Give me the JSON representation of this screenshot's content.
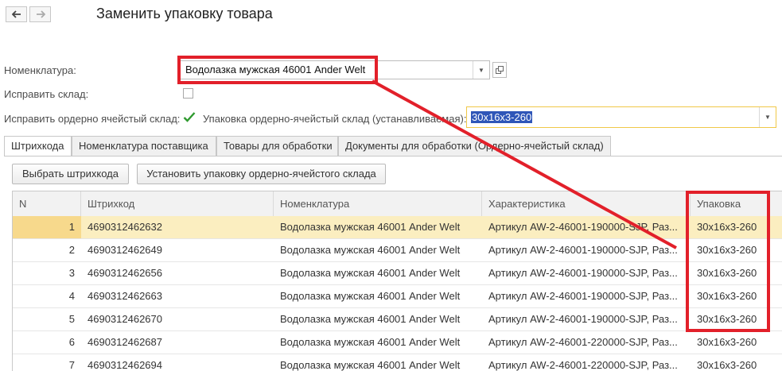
{
  "window": {
    "title": "Заменить упаковку товара"
  },
  "form": {
    "nomenclature_label": "Номенклатура:",
    "nomenclature_value": "Водолазка мужская 46001 Ander Welt",
    "fix_warehouse_label": "Исправить склад:",
    "fix_warehouse_checked": false,
    "fix_cell_warehouse_label": "Исправить ордерно ячейстый склад:",
    "fix_cell_warehouse_checked": true,
    "packaging_label": "Упаковка ордерно-ячейстый склад (устанавливаемая):",
    "packaging_value": "30x16x3-260"
  },
  "tabs": [
    {
      "label": "Штрихкода",
      "active": true
    },
    {
      "label": "Номенклатура поставщика",
      "active": false
    },
    {
      "label": "Товары для обработки",
      "active": false
    },
    {
      "label": "Документы для обработки (Ордерно-ячейстый склад)",
      "active": false
    }
  ],
  "toolbar": {
    "select_barcodes": "Выбрать штрихкода",
    "set_packaging": "Установить упаковку ордерно-ячейстого склада"
  },
  "table": {
    "columns": [
      "N",
      "Штрихкод",
      "Номенклатура",
      "Характеристика",
      "Упаковка"
    ],
    "rows": [
      {
        "n": "1",
        "barcode": "4690312462632",
        "nomenclature": "Водолазка мужская 46001 Ander Welt",
        "characteristic": "Артикул AW-2-46001-190000-SJP, Раз...",
        "packaging": "30x16x3-260"
      },
      {
        "n": "2",
        "barcode": "4690312462649",
        "nomenclature": "Водолазка мужская 46001 Ander Welt",
        "characteristic": "Артикул AW-2-46001-190000-SJP, Раз...",
        "packaging": "30x16x3-260"
      },
      {
        "n": "3",
        "barcode": "4690312462656",
        "nomenclature": "Водолазка мужская 46001 Ander Welt",
        "characteristic": "Артикул AW-2-46001-190000-SJP, Раз...",
        "packaging": "30x16x3-260"
      },
      {
        "n": "4",
        "barcode": "4690312462663",
        "nomenclature": "Водолазка мужская 46001 Ander Welt",
        "characteristic": "Артикул AW-2-46001-190000-SJP, Раз...",
        "packaging": "30x16x3-260"
      },
      {
        "n": "5",
        "barcode": "4690312462670",
        "nomenclature": "Водолазка мужская 46001 Ander Welt",
        "characteristic": "Артикул AW-2-46001-190000-SJP, Раз...",
        "packaging": "30x16x3-260"
      },
      {
        "n": "6",
        "barcode": "4690312462687",
        "nomenclature": "Водолазка мужская 46001 Ander Welt",
        "characteristic": "Артикул AW-2-46001-220000-SJP, Раз...",
        "packaging": "30x16x3-260"
      },
      {
        "n": "7",
        "barcode": "4690312462694",
        "nomenclature": "Водолазка мужская 46001 Ander Welt",
        "characteristic": "Артикул AW-2-46001-220000-SJP, Раз...",
        "packaging": "30x16x3-260"
      }
    ]
  },
  "colors": {
    "annotation_red": "#e2202a",
    "selected_row": "#fbeec0",
    "packaging_highlight": "#2f56b8"
  }
}
